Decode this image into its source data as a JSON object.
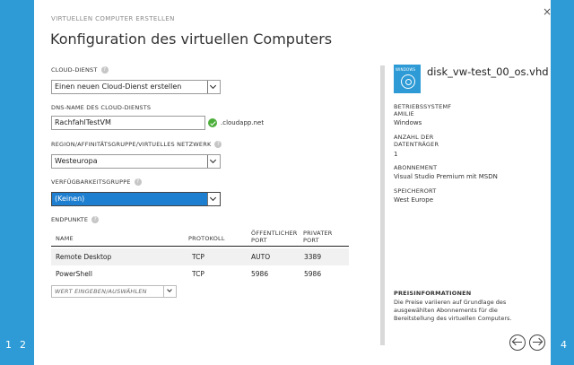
{
  "wizard": {
    "header": "VIRTUELLEN COMPUTER ERSTELLEN",
    "title": "Konfiguration des virtuellen Computers",
    "close": "×",
    "steps_left": [
      "1",
      "2"
    ],
    "step_right": "4"
  },
  "form": {
    "cloud_service": {
      "label": "CLOUD-DIENST",
      "value": "Einen neuen Cloud-Dienst erstellen"
    },
    "dns_name": {
      "label": "DNS-NAME DES CLOUD-DIENSTS",
      "value": "RachfahlTestVM",
      "suffix": ".cloudapp.net"
    },
    "region": {
      "label": "REGION/AFFINITÄTSGRUPPE/VIRTUELLES NETZWERK",
      "value": "Westeuropa"
    },
    "availability_set": {
      "label": "VERFÜGBARKEITSGRUPPE",
      "value": "(Keinen)"
    }
  },
  "endpoints": {
    "label": "ENDPUNKTE",
    "columns": {
      "name": "NAME",
      "protocol": "PROTOKOLL",
      "public_port_1": "ÖFFENTLICHER",
      "public_port_2": "PORT",
      "private_port_1": "PRIVATER",
      "private_port_2": "PORT"
    },
    "rows": [
      {
        "name": "Remote Desktop",
        "protocol": "TCP",
        "public": "AUTO",
        "private": "3389"
      },
      {
        "name": "PowerShell",
        "protocol": "TCP",
        "public": "5986",
        "private": "5986"
      }
    ],
    "add_placeholder": "WERT EINGEBEN/AUSWÄHLEN"
  },
  "summary": {
    "disk_icon_label": "WINDOWS",
    "disk_name": "disk_vw-test_00_os.vhd",
    "os_family_label_1": "BETRIEBSSYSTEMF",
    "os_family_label_2": "AMILIE",
    "os_family_value": "Windows",
    "disk_count_label_1": "ANZAHL DER",
    "disk_count_label_2": "DATENTRÄGER",
    "disk_count_value": "1",
    "subscription_label": "ABONNEMENT",
    "subscription_value": "Visual Studio Premium mit MSDN",
    "location_label": "SPEICHERORT",
    "location_value": "West Europe",
    "pricing_label": "PREISINFORMATIONEN",
    "pricing_text": "Die Preise variieren auf Grundlage des ausgewählten Abonnements für die Bereitstellung des virtuellen Computers."
  },
  "colors": {
    "accent": "#2e9bd6",
    "selected": "#1e7fd1",
    "valid": "#4cae3a"
  },
  "icons": {
    "help": "question-mark-circle",
    "valid": "check-circle",
    "prev": "arrow-left-circle",
    "next": "arrow-right-circle"
  }
}
